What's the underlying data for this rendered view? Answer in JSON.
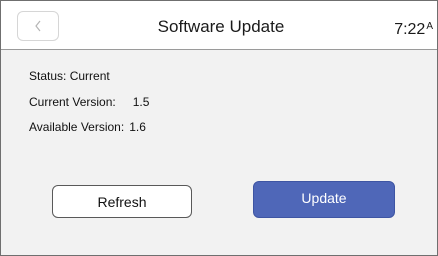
{
  "header": {
    "back_icon": "chevron-left-icon",
    "title": "Software Update",
    "time": "7:22",
    "ampm": "A"
  },
  "info": {
    "status_label": "Status:",
    "status_value": "Current",
    "current_version_label": "Current Version:",
    "current_version_value": "1.5",
    "available_version_label": "Available Version:",
    "available_version_value": "1.6"
  },
  "buttons": {
    "refresh_label": "Refresh",
    "update_label": "Update"
  },
  "colors": {
    "background": "#f2f2f2",
    "header_background": "#ffffff",
    "accent": "#4f67b8"
  }
}
